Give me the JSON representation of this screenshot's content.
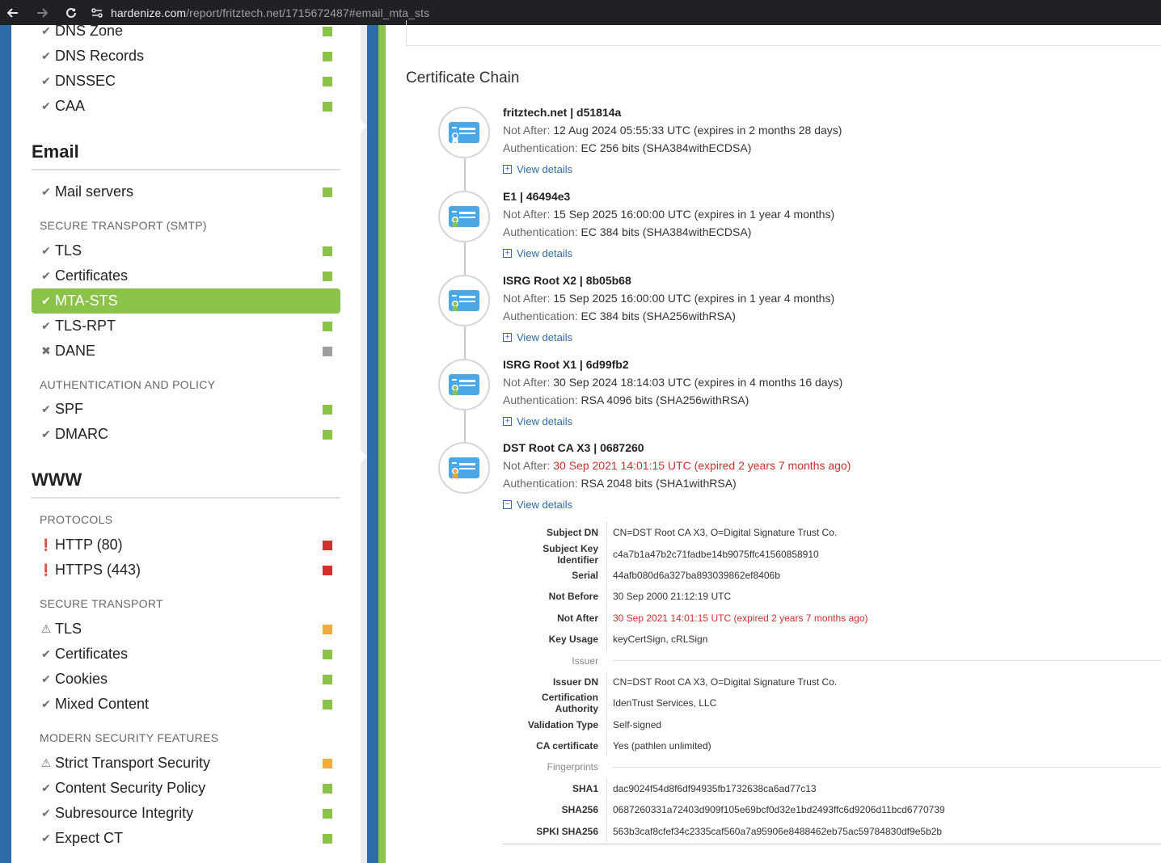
{
  "browser": {
    "url_host": "hardenize.com",
    "url_path": "/report/fritztech.net/1715672487#email_mta_sts"
  },
  "sidebar": {
    "dns_items": [
      {
        "label": "DNS Zone",
        "icon": "check-icon",
        "status": "green"
      },
      {
        "label": "DNS Records",
        "icon": "check-icon",
        "status": "green"
      },
      {
        "label": "DNSSEC",
        "icon": "check-icon",
        "status": "green"
      },
      {
        "label": "CAA",
        "icon": "check-icon",
        "status": "green"
      }
    ],
    "email": {
      "title": "Email",
      "mail_servers": "Mail servers",
      "smtp_heading": "SECURE TRANSPORT (SMTP)",
      "tls": "TLS",
      "certificates": "Certificates",
      "mta_sts": "MTA-STS",
      "tls_rpt": "TLS-RPT",
      "dane": "DANE",
      "auth_heading": "AUTHENTICATION AND POLICY",
      "spf": "SPF",
      "dmarc": "DMARC"
    },
    "www": {
      "title": "WWW",
      "protocols_heading": "PROTOCOLS",
      "http": "HTTP (80)",
      "https": "HTTPS (443)",
      "secure_heading": "SECURE TRANSPORT",
      "tls": "TLS",
      "certificates": "Certificates",
      "cookies": "Cookies",
      "mixed": "Mixed Content",
      "modern_heading": "MODERN SECURITY FEATURES",
      "hsts": "Strict Transport Security",
      "csp": "Content Security Policy",
      "sri": "Subresource Integrity",
      "expect_ct": "Expect CT"
    },
    "colors": {
      "green": "#8bc34a",
      "gray": "#9e9e9e",
      "red": "#d32f2f",
      "orange": "#f0ad3c",
      "blue": "#2e6ba8"
    }
  },
  "main": {
    "chain_title": "Certificate Chain",
    "certs": [
      {
        "name": "fritztech.net | d51814a",
        "not_after_label": "Not After:",
        "not_after": "12 Aug 2024 05:55:33 UTC (expires in 2 months 28 days)",
        "auth_label": "Authentication:",
        "auth": "EC 256 bits (SHA384withECDSA)",
        "view": "View details",
        "badge": "blue",
        "expired": false
      },
      {
        "name": "E1 | 46494e3",
        "not_after_label": "Not After:",
        "not_after": "15 Sep 2025 16:00:00 UTC (expires in 1 year 4 months)",
        "auth_label": "Authentication:",
        "auth": "EC 384 bits (SHA384withECDSA)",
        "view": "View details",
        "badge": "green",
        "expired": false
      },
      {
        "name": "ISRG Root X2 | 8b05b68",
        "not_after_label": "Not After:",
        "not_after": "15 Sep 2025 16:00:00 UTC (expires in 1 year 4 months)",
        "auth_label": "Authentication:",
        "auth": "EC 384 bits (SHA256withRSA)",
        "view": "View details",
        "badge": "green",
        "expired": false
      },
      {
        "name": "ISRG Root X1 | 6d99fb2",
        "not_after_label": "Not After:",
        "not_after": "30 Sep 2024 18:14:03 UTC (expires in 4 months 16 days)",
        "auth_label": "Authentication:",
        "auth": "RSA 4096 bits (SHA256withRSA)",
        "view": "View details",
        "badge": "green",
        "expired": false
      },
      {
        "name": "DST Root CA X3 | 0687260",
        "not_after_label": "Not After:",
        "not_after": "30 Sep 2021 14:01:15 UTC (expired 2 years 7 months ago)",
        "auth_label": "Authentication:",
        "auth": "RSA 2048 bits (SHA1withRSA)",
        "view": "View details",
        "badge": "orange",
        "expired": true
      }
    ],
    "details": {
      "subject_dn_k": "Subject DN",
      "subject_dn": "CN=DST Root CA X3, O=Digital Signature Trust Co.",
      "ski_k": "Subject Key Identifier",
      "ski": "c4a7b1a47b2c71fadbe14b9075ffc41560858910",
      "serial_k": "Serial",
      "serial": "44afb080d6a327ba893039862ef8406b",
      "not_before_k": "Not Before",
      "not_before": "30 Sep 2000 21:12:19 UTC",
      "not_after_k": "Not After",
      "not_after": "30 Sep 2021 14:01:15 UTC (expired 2 years 7 months ago)",
      "key_usage_k": "Key Usage",
      "key_usage": "keyCertSign, cRLSign",
      "issuer_group": "Issuer",
      "issuer_dn_k": "Issuer DN",
      "issuer_dn": "CN=DST Root CA X3, O=Digital Signature Trust Co.",
      "ca_k": "Certification Authority",
      "ca": "IdenTrust Services, LLC",
      "validation_k": "Validation Type",
      "validation": "Self-signed",
      "ca_cert_k": "CA certificate",
      "ca_cert": "Yes (pathlen unlimited)",
      "fp_group": "Fingerprints",
      "sha1_k": "SHA1",
      "sha1": "dac9024f54d8f6df94935fb1732638ca6ad77c13",
      "sha256_k": "SHA256",
      "sha256": "0687260331a72403d909f105e69bcf0d32e1bd2493ffc6d9206d11bcd6770739",
      "spki_k": "SPKI SHA256",
      "spki": "563b3caf8cfef34c2335caf560a7a95906e8488462eb75ac59784830df9e5b2b"
    }
  }
}
